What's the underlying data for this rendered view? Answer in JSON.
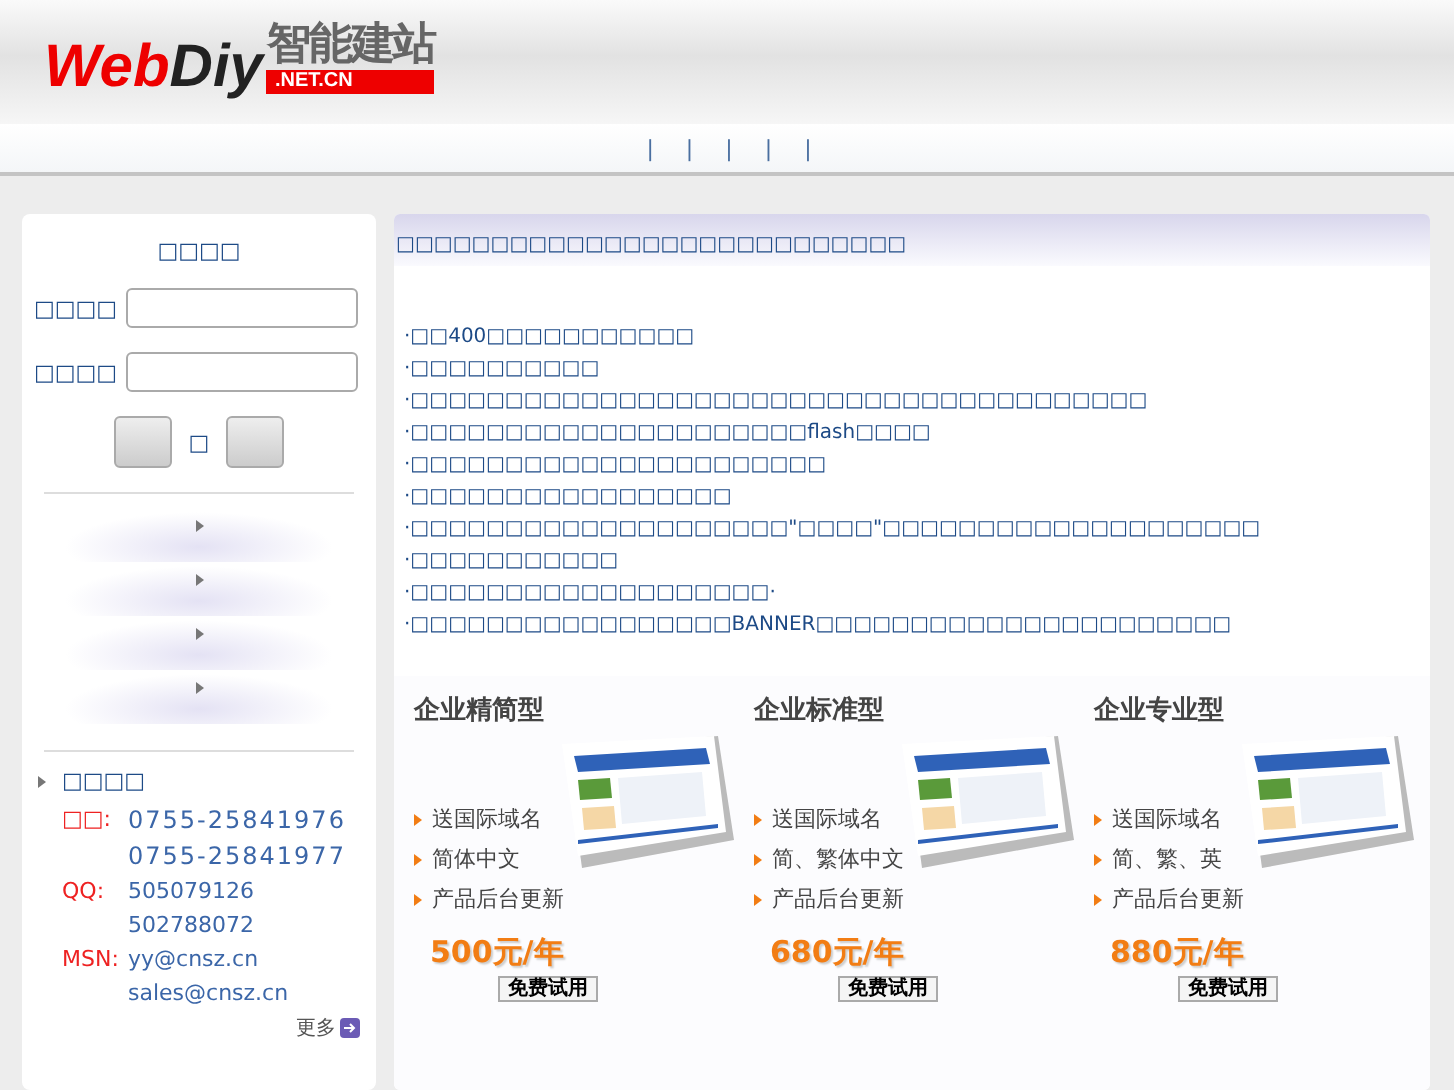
{
  "logo": {
    "word_red": "Web",
    "word_dark": "Diy",
    "tagline": "智能建站",
    "domain": ".NET.CN"
  },
  "nav": {
    "separators": [
      "|",
      "|",
      "|",
      "|",
      "|"
    ]
  },
  "login": {
    "title": "□□□□",
    "fields": [
      {
        "label": "□□□□"
      },
      {
        "label": "□□□□"
      }
    ],
    "between": "□"
  },
  "menu": {
    "items": [
      {
        "kind": "menu"
      },
      {
        "kind": "menu"
      },
      {
        "kind": "menu"
      },
      {
        "kind": "menu"
      }
    ]
  },
  "contact": {
    "title": "□□□□",
    "rows": [
      {
        "label": "□□:",
        "value": "0755-25841976"
      },
      {
        "label": "",
        "value": "0755-25841977"
      },
      {
        "label": "QQ:",
        "value": "505079126"
      },
      {
        "label": "",
        "value": "502788072"
      },
      {
        "label": "MSN:",
        "value": "yy@cnsz.cn"
      },
      {
        "label": "",
        "value": "sales@cnsz.cn"
      }
    ],
    "more": "更多"
  },
  "intro": {
    "title": "□□□□□□□□□□□□□□□□□□□□□□□□□□□",
    "lines": [
      "·□□400□□□□□□□□□□□",
      "·□□□□□□□□□□",
      "·□□□□□□□□□□□□□□□□□□□□□□□□□□□□□□□□□□□□□□□",
      "·□□□□□□□□□□□□□□□□□□□□□flash□□□□",
      "·□□□□□□□□□□□□□□□□□□□□□□",
      "·□□□□□□□□□□□□□□□□□",
      "·□□□□□□□□□□□□□□□□□□□□\"□□□□\"□□□□□□□□□□□□□□□□□□□□",
      "·□□□□□□□□□□□",
      "·□□□□□□□□□□□□□□□□□□□·",
      "·□□□□□□□□□□□□□□□□□BANNER□□□□□□□□□□□□□□□□□□□□□□"
    ]
  },
  "plans": [
    {
      "name": "企业精简型",
      "features": [
        "送国际域名",
        "简体中文",
        "产品后台更新"
      ],
      "price": "500元/年",
      "button": "免费试用"
    },
    {
      "name": "企业标准型",
      "features": [
        "送国际域名",
        "简、繁体中文",
        "产品后台更新"
      ],
      "price": "680元/年",
      "button": "免费试用"
    },
    {
      "name": "企业专业型",
      "features": [
        "送国际域名",
        "简、繁、英",
        "产品后台更新"
      ],
      "price": "880元/年",
      "button": "免费试用"
    }
  ]
}
